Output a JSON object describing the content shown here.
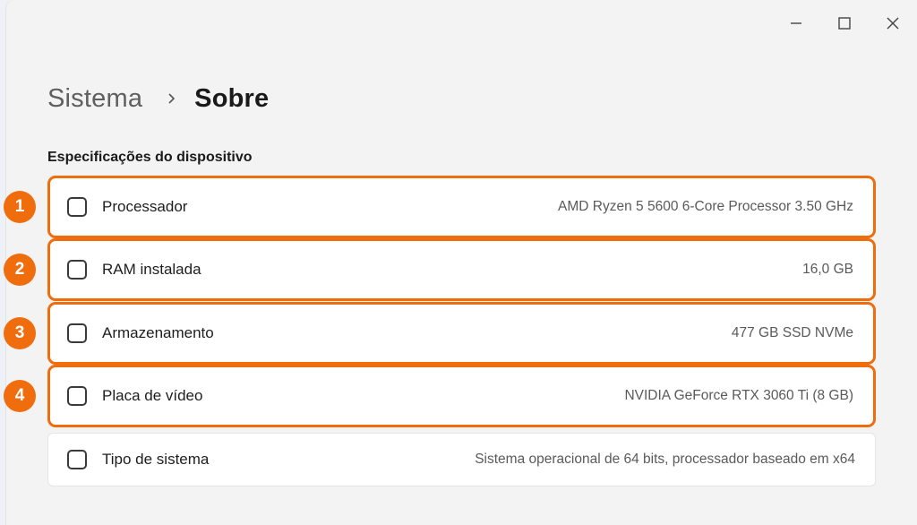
{
  "window_controls": {
    "minimize": "minimize-icon",
    "maximize": "maximize-icon",
    "close": "close-icon"
  },
  "breadcrumb": {
    "parent": "Sistema",
    "separator_icon": "chevron-right-icon",
    "current": "Sobre"
  },
  "section": {
    "title": "Especificações do dispositivo"
  },
  "specs": [
    {
      "label": "Processador",
      "value": "AMD Ryzen 5 5600 6-Core Processor 3.50 GHz",
      "badge": "1"
    },
    {
      "label": "RAM instalada",
      "value": "16,0 GB",
      "badge": "2"
    },
    {
      "label": "Armazenamento",
      "value": "477 GB SSD NVMe",
      "badge": "3"
    },
    {
      "label": "Placa de vídeo",
      "value": "NVIDIA GeForce RTX 3060 Ti (8 GB)",
      "badge": "4"
    },
    {
      "label": "Tipo de sistema",
      "value": "Sistema operacional de 64 bits, processador baseado em x64"
    }
  ],
  "colors": {
    "highlight": "#f06d0e",
    "background": "#f3f3f3",
    "card": "#ffffff"
  }
}
